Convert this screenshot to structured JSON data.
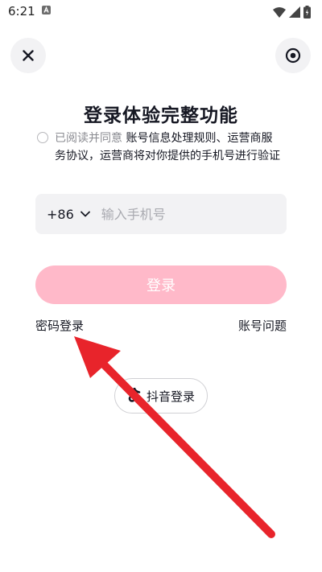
{
  "status_bar": {
    "time": "6:21"
  },
  "top_bar": {
    "close_icon": "close-icon",
    "right_icon": "target-icon"
  },
  "page": {
    "title": "登录体验完整功能"
  },
  "agreement": {
    "prefix": "已阅读并同意 ",
    "links_line1": "账号信息处理规则、运营商服",
    "line2": "务协议，运营商将对你提供的手机号进行验证"
  },
  "phone": {
    "country_code": "+86",
    "placeholder": "输入手机号",
    "value": ""
  },
  "actions": {
    "login_label": "登录",
    "password_login": "密码登录",
    "account_problem": "账号问题",
    "douyin_login": "抖音登录"
  },
  "colors": {
    "login_button": "#ffb9c9",
    "arrow": "#e8242b"
  }
}
